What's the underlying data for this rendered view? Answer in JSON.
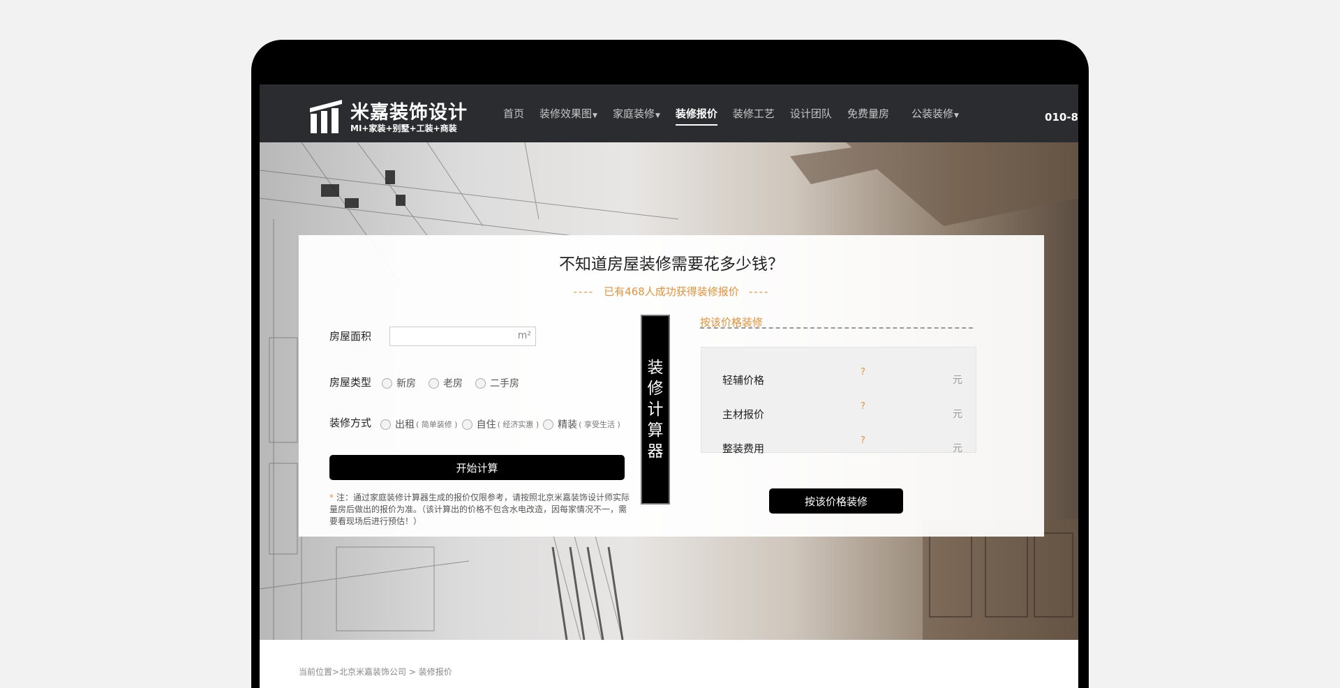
{
  "header": {
    "logo_name": "米嘉装饰设计",
    "logo_tagline": "MI+家装+别墅+工装+商装",
    "phone": "010-8",
    "nav": [
      {
        "label": "首页",
        "dropdown": false,
        "active": false
      },
      {
        "label": "装修效果图",
        "dropdown": true,
        "active": false
      },
      {
        "label": "家庭装修",
        "dropdown": true,
        "active": false
      },
      {
        "label": "装修报价",
        "dropdown": false,
        "active": true
      },
      {
        "label": "装修工艺",
        "dropdown": false,
        "active": false
      },
      {
        "label": "设计团队",
        "dropdown": false,
        "active": false
      },
      {
        "label": "免费量房",
        "dropdown": false,
        "active": false
      },
      {
        "label": "公装装修",
        "dropdown": true,
        "active": false
      }
    ]
  },
  "calculator": {
    "title": "不知道房屋装修需要花多少钱？",
    "subtitle_dash": "----",
    "subtitle": "已有468人成功获得装修报价",
    "vertical_label": [
      "装",
      "修",
      "计",
      "算",
      "器"
    ],
    "area": {
      "label": "房屋面积",
      "value": "",
      "unit": "m²"
    },
    "house_type": {
      "label": "房屋类型",
      "options": [
        "新房",
        "老房",
        "二手房"
      ]
    },
    "decor_mode": {
      "label": "装修方式",
      "options": [
        {
          "label": "出租",
          "note": "( 简单装修 )"
        },
        {
          "label": "自住",
          "note": "( 经济实惠 )"
        },
        {
          "label": "精装",
          "note": "( 享受生活 )"
        }
      ]
    },
    "calc_button": "开始计算",
    "note_star": "*",
    "note": "注：通过家庭装修计算器生成的报价仅限参考，请按照北京米嘉装饰设计师实际量房后做出的报价为准。（该计算出的价格不包含水电改造，因每家情况不一，需要看现场后进行预估！）",
    "results_heading": "按该价格装修",
    "results": [
      {
        "label": "轻辅价格",
        "value": "?",
        "unit": "元"
      },
      {
        "label": "主材报价",
        "value": "?",
        "unit": "元"
      },
      {
        "label": "整装费用",
        "value": "?",
        "unit": "元"
      }
    ],
    "result_button": "按该价格装修"
  },
  "breadcrumb": "当前位置>北京米嘉装饰公司 > 装修报价",
  "colors": {
    "accent": "#e8913a",
    "header_bg": "#2b2c30",
    "button_bg": "#000000"
  }
}
